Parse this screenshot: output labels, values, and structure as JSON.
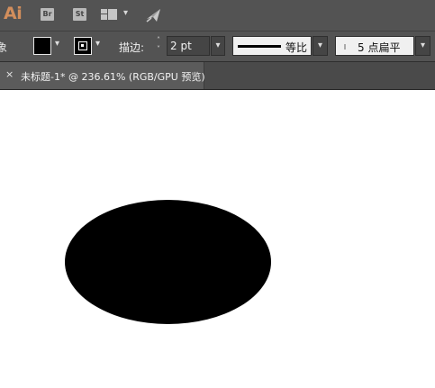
{
  "app": {
    "logo": "Ai",
    "bridge_label": "Br",
    "stock_label": "St"
  },
  "control_bar": {
    "cut_label": "象",
    "stroke_label": "描边:",
    "stroke_weight": "2 pt",
    "variable_width_profile": "等比",
    "brush_definition": "5 点扁平"
  },
  "tabs": [
    {
      "close": "×",
      "title": "未标题-1* @ 236.61% (RGB/GPU 预览)"
    }
  ],
  "colors": {
    "fill": "#000000",
    "stroke": "#000000",
    "ellipse": "#000000"
  },
  "icons": {
    "chevron": "⌄",
    "spinner_up": "˄",
    "spinner_down": "˅"
  }
}
